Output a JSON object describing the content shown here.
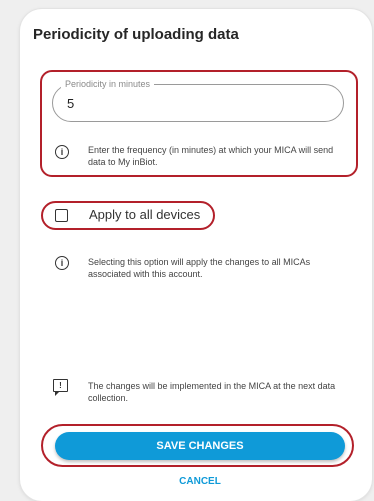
{
  "dialog": {
    "title": "Periodicity of uploading data"
  },
  "periodicity_field": {
    "label": "Periodicity in minutes",
    "value": "5"
  },
  "notes": {
    "frequency": "Enter the frequency (in minutes) at which your MICA will send data to My inBiot.",
    "apply_all": "Selecting this option will apply the changes to all MICAs associated with this account.",
    "implementation": "The changes will be implemented in the MICA at the next data collection."
  },
  "apply_all": {
    "label": "Apply to all devices",
    "checked": false
  },
  "actions": {
    "save_label": "SAVE CHANGES",
    "cancel_label": "CANCEL"
  },
  "icons": {
    "info": "info-icon",
    "message": "message-alert-icon",
    "info_glyph": "i",
    "message_glyph": "!"
  },
  "colors": {
    "accent": "#0f9ad8",
    "highlight": "#b3202a"
  }
}
